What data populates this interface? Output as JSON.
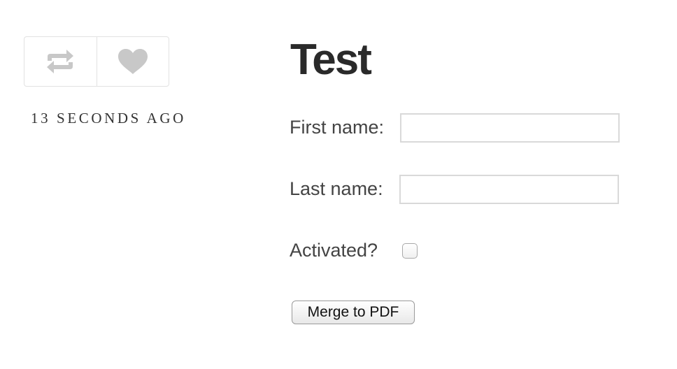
{
  "post": {
    "timestamp": "13 SECONDS AGO",
    "actions": [
      {
        "icon": "reblog-icon"
      },
      {
        "icon": "heart-icon"
      }
    ]
  },
  "form": {
    "title": "Test",
    "first_name_label": "First name:",
    "first_name_value": "",
    "last_name_label": "Last name:",
    "last_name_value": "",
    "activated_label": "Activated?",
    "activated_checked": false,
    "submit_label": "Merge to PDF"
  },
  "colors": {
    "icon": "#c8c8c8",
    "border": "#e2e2e2",
    "text": "#444444",
    "title": "#2a2a2a"
  }
}
